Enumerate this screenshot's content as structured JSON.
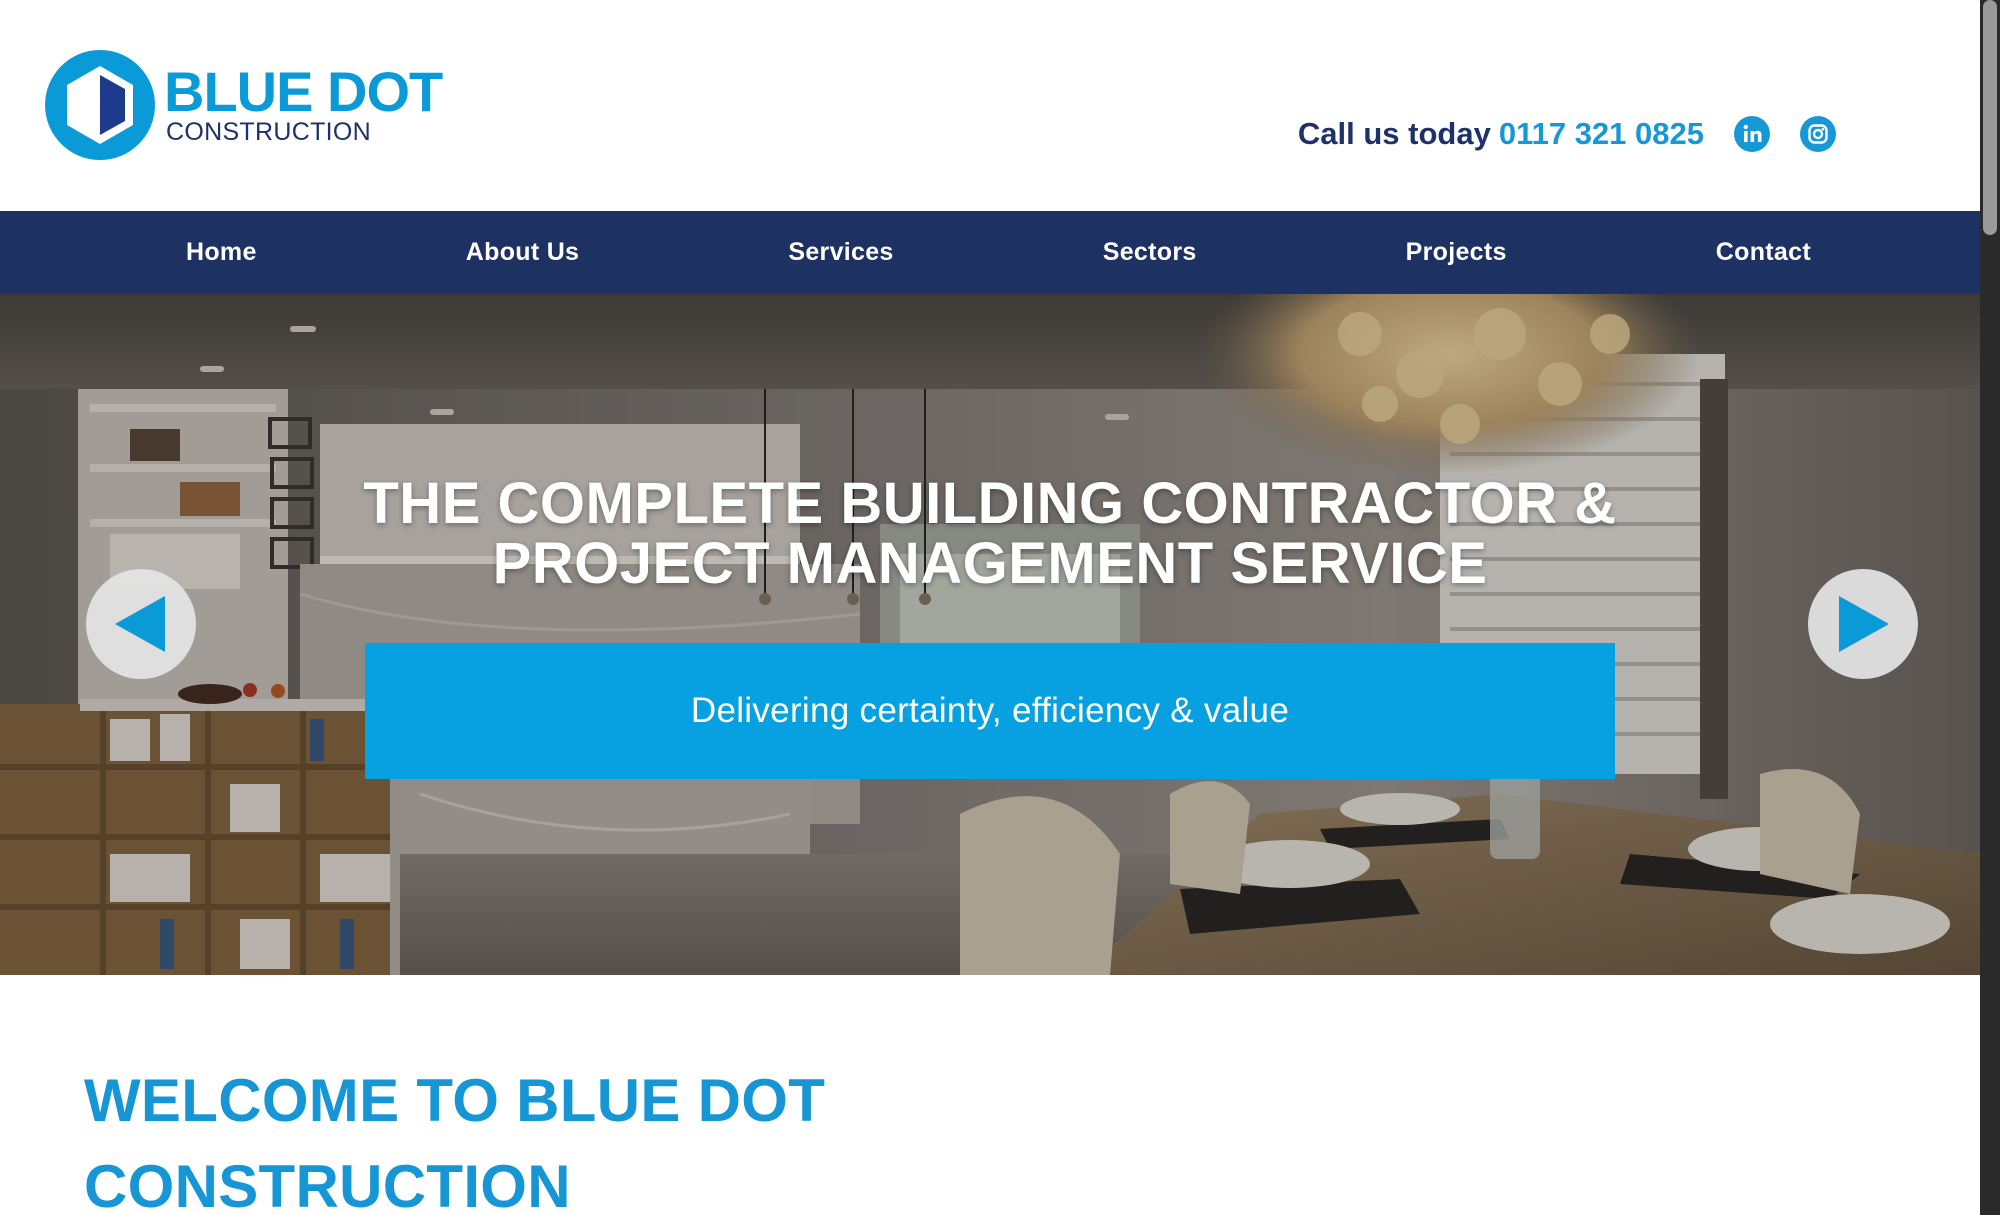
{
  "brand": {
    "name": "BLUE DOT",
    "tagline": "CONSTRUCTION",
    "color_primary": "#0a9ad8",
    "color_navy": "#1e3168"
  },
  "contact": {
    "call_label": "Call us today",
    "phone": "0117 321 0825",
    "social": [
      {
        "icon": "linkedin-icon"
      },
      {
        "icon": "instagram-icon"
      }
    ]
  },
  "nav": {
    "items": [
      "Home",
      "About Us",
      "Services",
      "Sectors",
      "Projects",
      "Contact"
    ],
    "background": "#1e3163"
  },
  "hero": {
    "title_line1": "THE COMPLETE BUILDING CONTRACTOR &",
    "title_line2": "PROJECT MANAGEMENT SERVICE",
    "subtitle": "Delivering certainty, efficiency & value",
    "banner_color": "#07a1e2",
    "prev_icon": "arrow-left-icon",
    "next_icon": "arrow-right-icon"
  },
  "welcome": {
    "line1": "WELCOME TO BLUE DOT",
    "line2": "CONSTRUCTION"
  }
}
